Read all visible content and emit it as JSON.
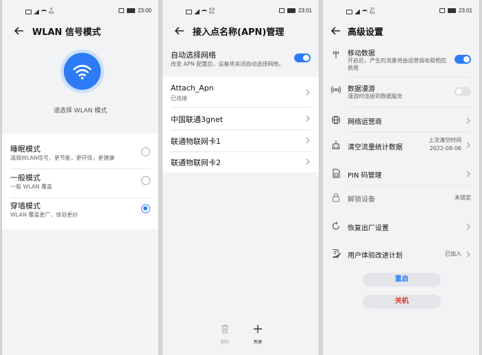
{
  "panels": [
    {
      "status": {
        "speed": "0\nK/s",
        "time": "23:00"
      },
      "title": "WLAN 信号模式",
      "hero_caption": "请选择 WLAN 模式",
      "modes": [
        {
          "title": "睡眠模式",
          "subtitle": "减弱WLAN信号，更节能，更环保，更健康",
          "selected": false
        },
        {
          "title": "一般模式",
          "subtitle": "一般 WLAN 覆盖",
          "selected": false
        },
        {
          "title": "穿墙模式",
          "subtitle": "WLAN 覆盖更广，体验更好",
          "selected": true
        }
      ]
    },
    {
      "status": {
        "speed": "4.6\nK/s",
        "time": "23:01"
      },
      "title": "接入点名称(APN)管理",
      "auto": {
        "title": "自动选择网络",
        "subtitle": "改变 APN 配置后，设备将关闭自动选择网络。",
        "on": true
      },
      "apns": [
        {
          "title": "Attach_Apn",
          "subtitle": "已连接"
        },
        {
          "title": "中国联通3gnet",
          "subtitle": ""
        },
        {
          "title": "联通物联网卡1",
          "subtitle": ""
        },
        {
          "title": "联通物联网卡2",
          "subtitle": ""
        }
      ],
      "actions": {
        "delete": "删除",
        "new": "新建"
      }
    },
    {
      "status": {
        "speed": "27\nK/s",
        "time": "23:01"
      },
      "title": "高级设置",
      "mobile_data": {
        "title": "移动数据",
        "subtitle": "开启后，产生的流量将由运营商收取相应费用",
        "on": true
      },
      "roaming": {
        "title": "数据漫游",
        "subtitle": "漫游时连接到数据服务",
        "on": false
      },
      "carrier": {
        "title": "网络运营商"
      },
      "clear_stats": {
        "title": "清空流量统计数据",
        "right1": "上次清空时间",
        "right2": "2022-08-06"
      },
      "pin": {
        "title": "PIN 码管理"
      },
      "unlock": {
        "title": "解锁设备",
        "right": "未锁定"
      },
      "factory": {
        "title": "恢复出厂设置"
      },
      "ux_plan": {
        "title": "用户体验改进计划",
        "right": "已加入"
      },
      "reboot": "重启",
      "shutdown": "关机"
    }
  ],
  "colors": {
    "accent": "#2d7cf6",
    "danger": "#e8322c"
  }
}
